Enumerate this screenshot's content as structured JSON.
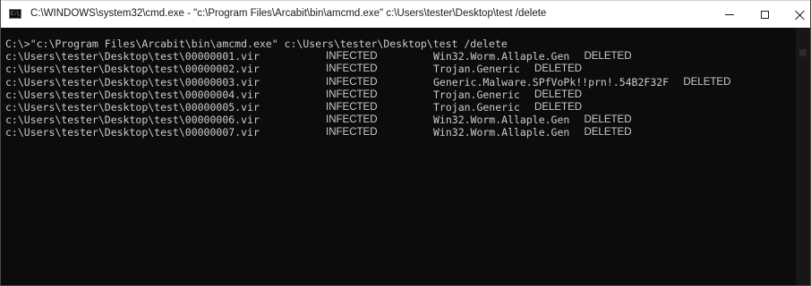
{
  "window": {
    "title": "C:\\WINDOWS\\system32\\cmd.exe - \"c:\\Program Files\\Arcabit\\bin\\amcmd.exe\"  c:\\Users\\tester\\Desktop\\test /delete",
    "icon": "cmd-console-icon",
    "icon_glyph": "C:\\"
  },
  "console": {
    "command_line": "C:\\>\"c:\\Program Files\\Arcabit\\bin\\amcmd.exe\" c:\\Users\\tester\\Desktop\\test /delete",
    "colors": {
      "background": "#0c0c0c",
      "text": "#cccccc"
    },
    "results": [
      {
        "path": "c:\\Users\\tester\\Desktop\\test\\00000001.vir",
        "status": "INFECTED",
        "threat": "Win32.Worm.Allaple.Gen",
        "action": "DELETED"
      },
      {
        "path": "c:\\Users\\tester\\Desktop\\test\\00000002.vir",
        "status": "INFECTED",
        "threat": "Trojan.Generic",
        "action": "DELETED"
      },
      {
        "path": "c:\\Users\\tester\\Desktop\\test\\00000003.vir",
        "status": "INFECTED",
        "threat": "Generic.Malware.SPfVoPk!!prn!.54B2F32F",
        "action": "DELETED"
      },
      {
        "path": "c:\\Users\\tester\\Desktop\\test\\00000004.vir",
        "status": "INFECTED",
        "threat": "Trojan.Generic",
        "action": "DELETED"
      },
      {
        "path": "c:\\Users\\tester\\Desktop\\test\\00000005.vir",
        "status": "INFECTED",
        "threat": "Trojan.Generic",
        "action": "DELETED"
      },
      {
        "path": "c:\\Users\\tester\\Desktop\\test\\00000006.vir",
        "status": "INFECTED",
        "threat": "Win32.Worm.Allaple.Gen",
        "action": "DELETED"
      },
      {
        "path": "c:\\Users\\tester\\Desktop\\test\\00000007.vir",
        "status": "INFECTED",
        "threat": "Win32.Worm.Allaple.Gen",
        "action": "DELETED"
      }
    ]
  }
}
